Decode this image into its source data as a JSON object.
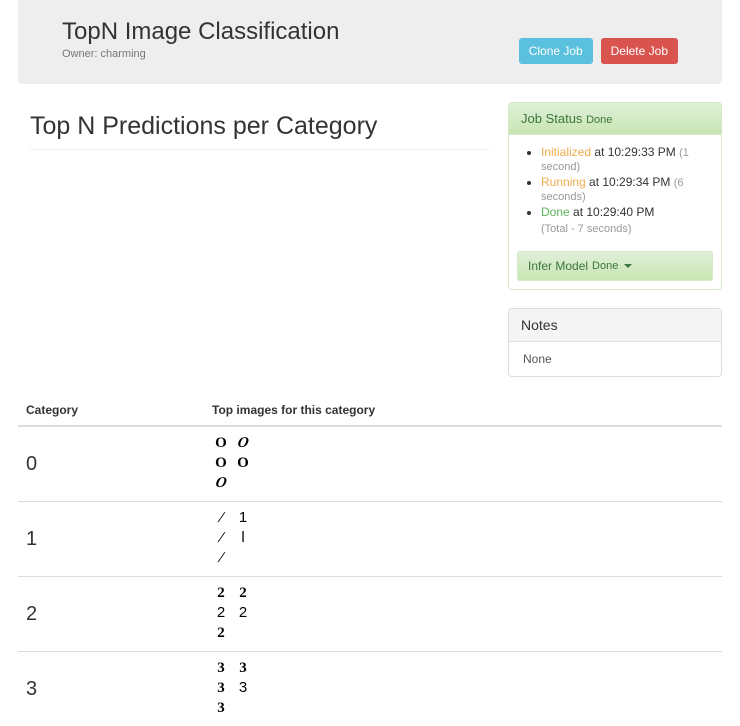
{
  "header": {
    "title": "TopN Image Classification",
    "owner_label": "Owner: charming",
    "clone_label": "Clone Job",
    "delete_label": "Delete Job"
  },
  "main": {
    "heading": "Top N Predictions per Category"
  },
  "job_status": {
    "title": "Job Status",
    "title_sub": "Done",
    "items": [
      {
        "state": "Initialized",
        "color": "orange",
        "at": " at 10:29:33 PM ",
        "dur": "(1 second)"
      },
      {
        "state": "Running",
        "color": "orange",
        "at": " at 10:29:34 PM ",
        "dur": "(6 seconds)"
      },
      {
        "state": "Done",
        "color": "green",
        "at": " at 10:29:40 PM",
        "dur": ""
      }
    ],
    "total": "(Total - 7 seconds)"
  },
  "infer_model": {
    "label": "Infer Model",
    "sub": "Done"
  },
  "notes": {
    "title": "Notes",
    "body": "None"
  },
  "table": {
    "col_category": "Category",
    "col_images": "Top images for this category",
    "rows": [
      {
        "category": "0"
      },
      {
        "category": "1"
      },
      {
        "category": "2"
      },
      {
        "category": "3"
      }
    ]
  }
}
